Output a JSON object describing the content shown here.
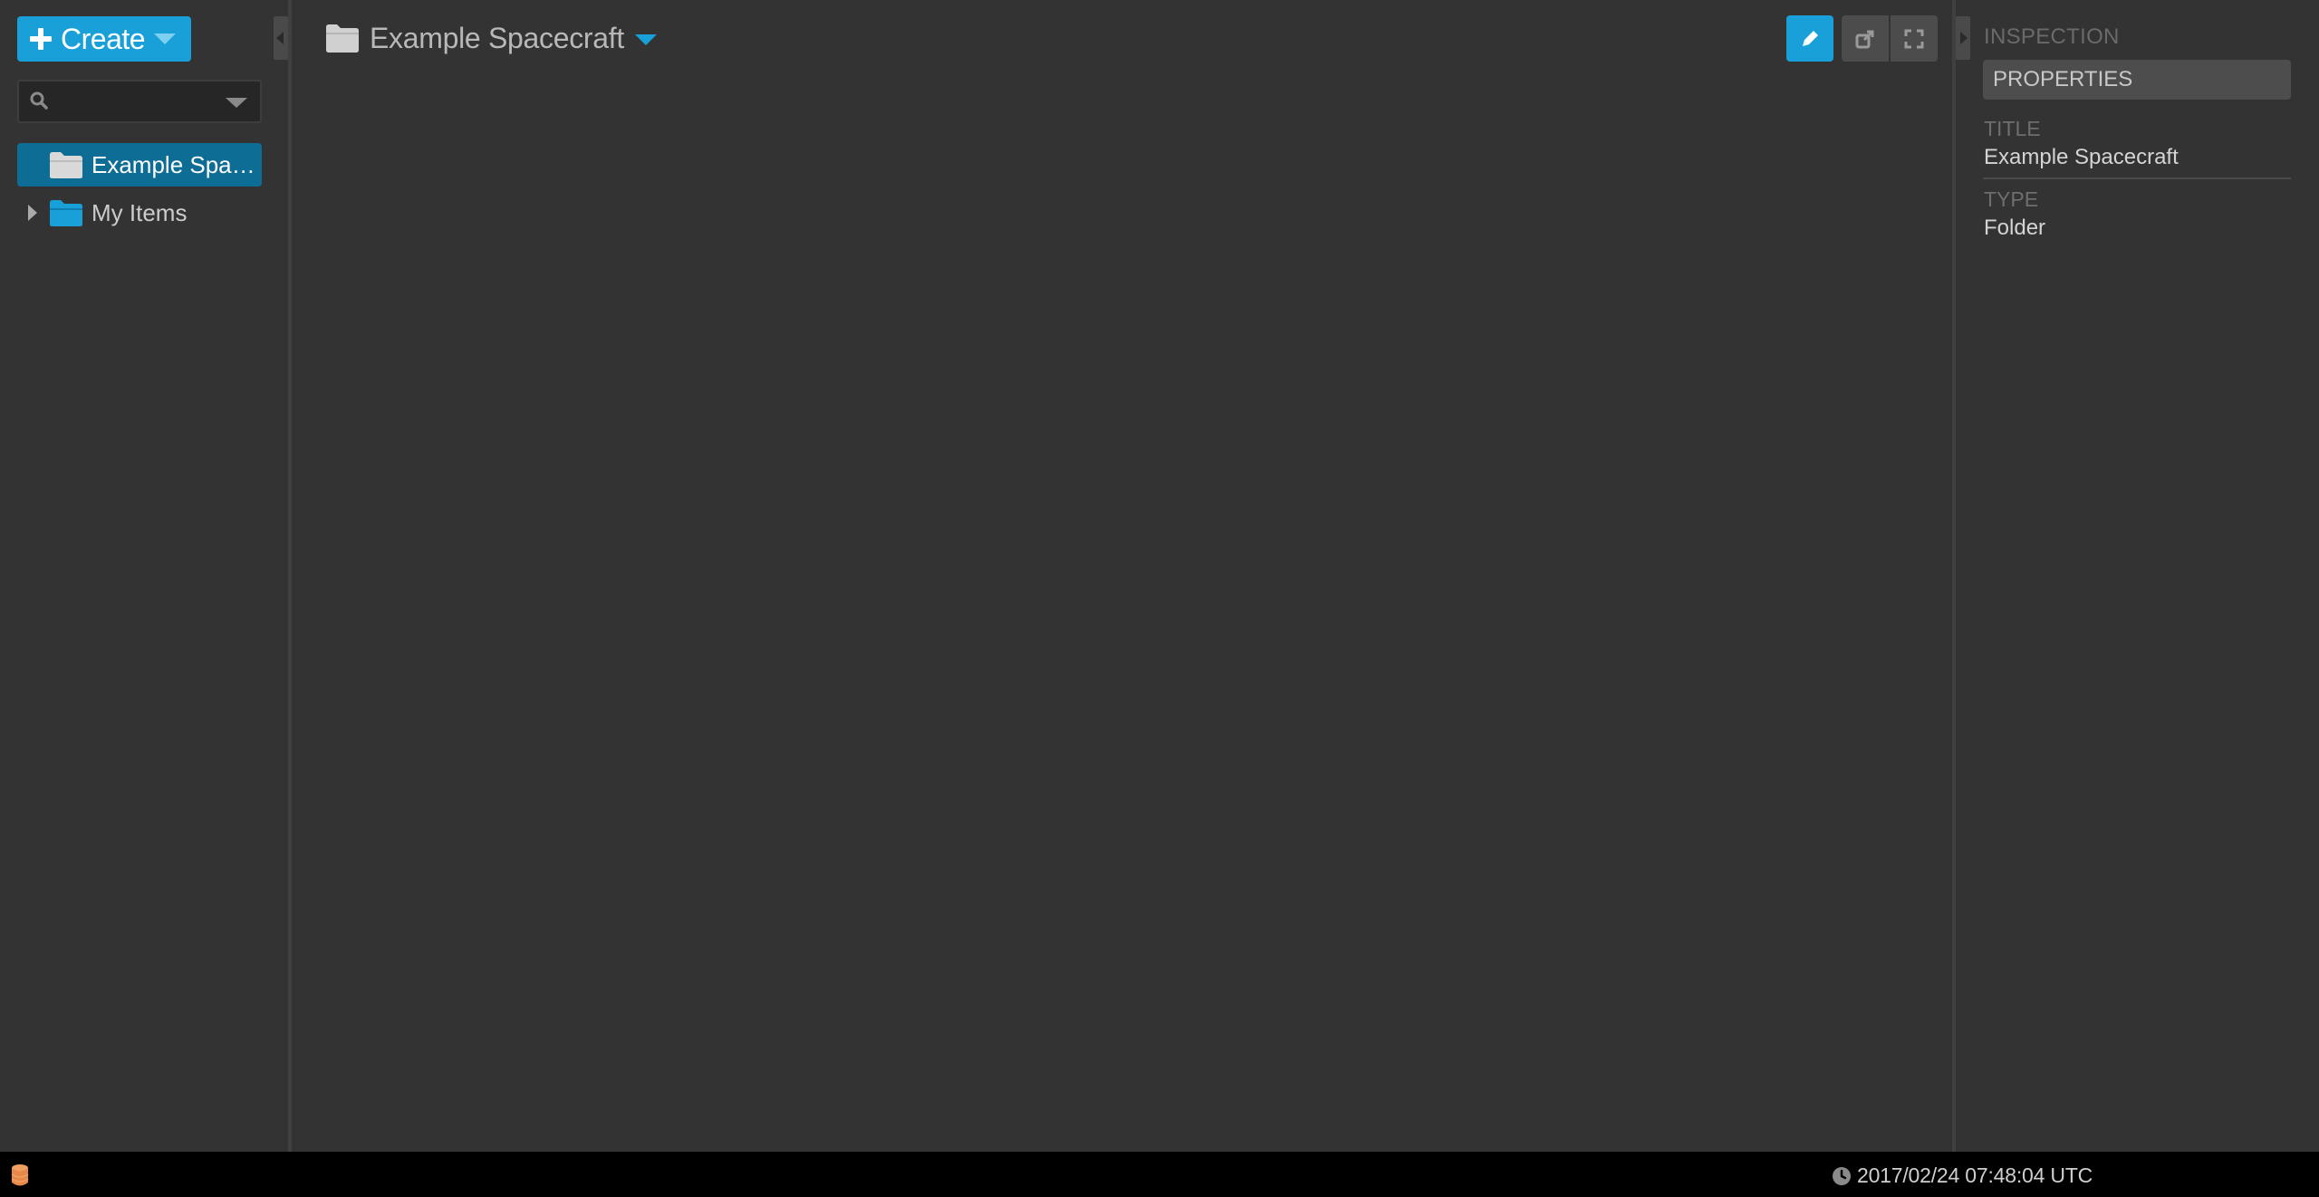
{
  "create_button": {
    "label": "Create"
  },
  "search": {
    "placeholder": "",
    "value": ""
  },
  "tree": {
    "items": [
      {
        "label": "Example Spac…",
        "selected": true,
        "expandable": false
      },
      {
        "label": "My Items",
        "selected": false,
        "expandable": true
      }
    ]
  },
  "main": {
    "title": "Example Spacecraft"
  },
  "inspector": {
    "heading": "INSPECTION",
    "tab": "PROPERTIES",
    "properties": [
      {
        "label": "TITLE",
        "value": "Example Spacecraft"
      },
      {
        "label": "TYPE",
        "value": "Folder"
      }
    ]
  },
  "status_bar": {
    "time": "2017/02/24 07:48:04 UTC"
  },
  "colors": {
    "accent": "#1aa0d8",
    "selected_item": "#0e6d95",
    "background": "#333333",
    "status_bar": "#000000",
    "db_indicator": "#f0a060"
  },
  "icons": {
    "create": "plus-icon",
    "search": "search-icon",
    "folder": "folder-icon",
    "edit": "pencil-icon",
    "new_tab": "new-tab-icon",
    "fullscreen": "fullscreen-icon",
    "database": "database-icon",
    "clock": "clock-icon"
  }
}
